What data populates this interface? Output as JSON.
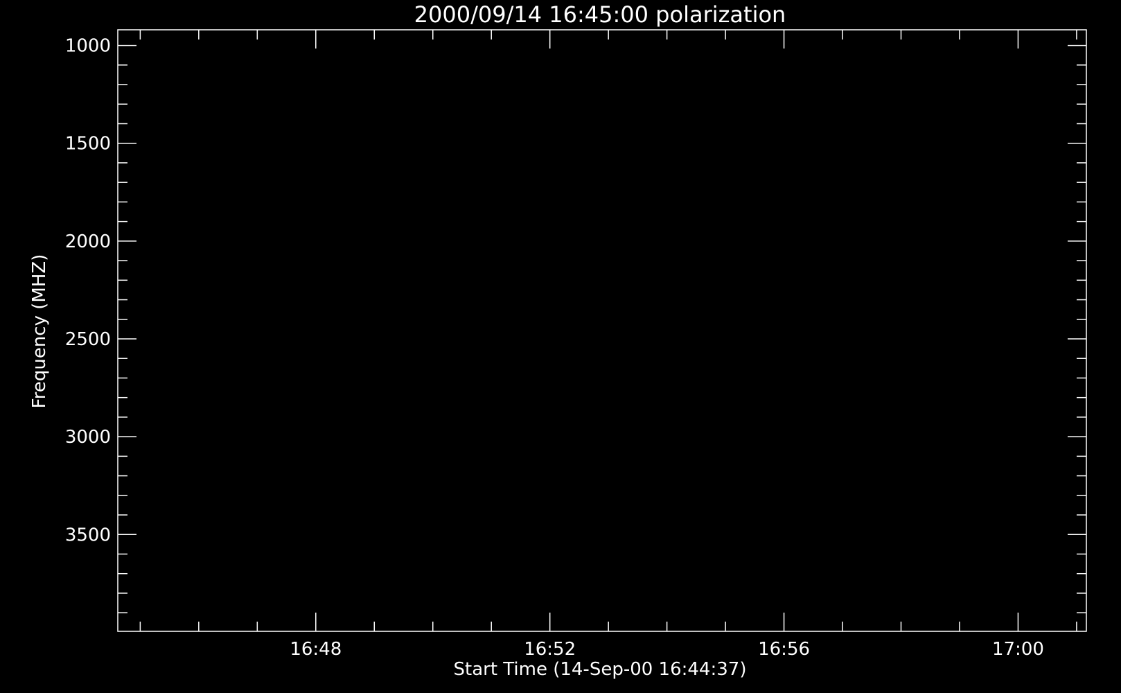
{
  "chart_data": {
    "type": "heatmap",
    "title": "2000/09/14 16:45:00 polarization",
    "xlabel": "Start Time (14-Sep-00 16:44:37)",
    "ylabel": "Frequency (MHZ)",
    "x_major_ticks": [
      "16:48",
      "16:52",
      "16:56",
      "17:00"
    ],
    "x_start": "16:44:37",
    "x_range": [
      "16:44:37",
      "17:01:10"
    ],
    "x_minor_step_minutes": 1,
    "y_ticks": [
      1000,
      1500,
      2000,
      2500,
      3000,
      3500
    ],
    "y_minor_step": 100,
    "ylim": [
      3995,
      920
    ],
    "y_inverted": true,
    "grid": false,
    "values": []
  },
  "colors": {
    "background": "#000000",
    "foreground": "#ffffff"
  }
}
